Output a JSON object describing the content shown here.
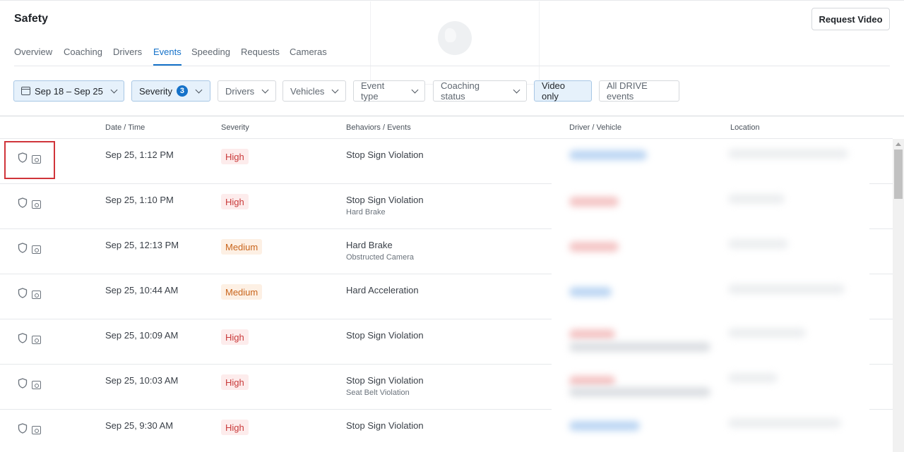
{
  "header": {
    "title": "Safety",
    "request_video_label": "Request Video"
  },
  "tabs": [
    {
      "label": "Overview"
    },
    {
      "label": "Coaching"
    },
    {
      "label": "Drivers"
    },
    {
      "label": "Events",
      "active": true
    },
    {
      "label": "Speeding"
    },
    {
      "label": "Requests"
    },
    {
      "label": "Cameras"
    }
  ],
  "filters": {
    "date_range": "Sep 18 – Sep 25",
    "severity": {
      "label": "Severity",
      "count": "3"
    },
    "drivers": "Drivers",
    "vehicles": "Vehicles",
    "event_type": "Event type",
    "coaching_status": "Coaching status",
    "video_only": "Video only",
    "all_drive_events": "All DRIVE events"
  },
  "columns": {
    "date_time": "Date / Time",
    "severity": "Severity",
    "behaviors": "Behaviors / Events",
    "driver_vehicle": "Driver / Vehicle",
    "location": "Location"
  },
  "rows": [
    {
      "datetime": "Sep 25, 1:12 PM",
      "severity": "High",
      "level": "high",
      "behavior": "Stop Sign Violation",
      "secondary": ""
    },
    {
      "datetime": "Sep 25, 1:10 PM",
      "severity": "High",
      "level": "high",
      "behavior": "Stop Sign Violation",
      "secondary": "Hard Brake"
    },
    {
      "datetime": "Sep 25, 12:13 PM",
      "severity": "Medium",
      "level": "medium",
      "behavior": "Hard Brake",
      "secondary": "Obstructed Camera"
    },
    {
      "datetime": "Sep 25, 10:44 AM",
      "severity": "Medium",
      "level": "medium",
      "behavior": "Hard Acceleration",
      "secondary": ""
    },
    {
      "datetime": "Sep 25, 10:09 AM",
      "severity": "High",
      "level": "high",
      "behavior": "Stop Sign Violation",
      "secondary": ""
    },
    {
      "datetime": "Sep 25, 10:03 AM",
      "severity": "High",
      "level": "high",
      "behavior": "Stop Sign Violation",
      "secondary": "Seat Belt Violation"
    },
    {
      "datetime": "Sep 25, 9:30 AM",
      "severity": "High",
      "level": "high",
      "behavior": "Stop Sign Violation",
      "secondary": ""
    }
  ],
  "colors": {
    "accent": "#1572c9",
    "high": "#c93a3a",
    "medium": "#c9651c",
    "highlight": "#d0343a"
  }
}
